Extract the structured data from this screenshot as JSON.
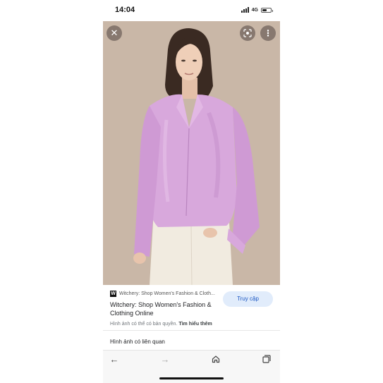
{
  "status_bar": {
    "time": "14:04",
    "network": "4G",
    "battery_level": 0.5
  },
  "image_viewer": {
    "close_icon": "close-icon",
    "lens_icon": "lens-icon",
    "more_icon": "more-vertical-icon"
  },
  "result": {
    "source_logo": "W",
    "source_name": "Witchery: Shop Women's Fashion & Cloth...",
    "title": "Witchery: Shop Women's Fashion & Clothing Online",
    "visit_label": "Truy cập",
    "copyright_text": "Hình ảnh có thể có bản quyền.",
    "learn_more_label": "Tìm hiểu thêm"
  },
  "related": {
    "heading": "Hình ảnh có liên quan"
  },
  "nav": {
    "back_icon": "arrow-left-icon",
    "forward_icon": "arrow-right-icon",
    "home_icon": "home-icon",
    "tabs_icon": "tabs-icon"
  },
  "colors": {
    "blouse": "#d8a8dc",
    "background": "#c8b6a6",
    "visit_bg": "#e1ecfb",
    "visit_text": "#1a56c2"
  }
}
